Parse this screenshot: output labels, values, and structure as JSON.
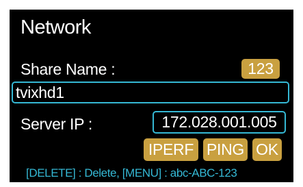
{
  "header": {
    "title": "Network"
  },
  "share": {
    "label": "Share Name :",
    "input_mode_label": "123",
    "value": "tvixhd1"
  },
  "server": {
    "label": "Server IP :",
    "ip_value": "172.028.001.005"
  },
  "actions": {
    "iperf_label": "IPERF",
    "ping_label": "PING",
    "ok_label": "OK"
  },
  "footer": {
    "hint": "[DELETE] : Delete, [MENU] : abc-ABC-123"
  },
  "colors": {
    "background": "#000000",
    "accent_button": "#c9a040",
    "focus_border": "#35b8d4",
    "hint_text": "#35b8d4",
    "text": "#ffffff"
  }
}
